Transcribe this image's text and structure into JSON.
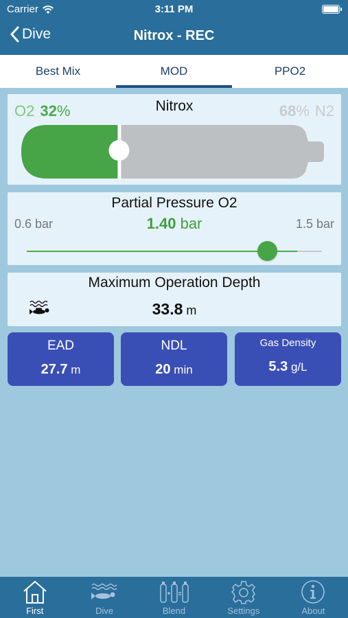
{
  "status_bar": {
    "carrier": "Carrier",
    "time": "3:11 PM"
  },
  "nav": {
    "back_label": "Dive",
    "title": "Nitrox - REC"
  },
  "tabs": [
    {
      "label": "Best Mix",
      "active": false
    },
    {
      "label": "MOD",
      "active": true
    },
    {
      "label": "PPO2",
      "active": false
    }
  ],
  "mix": {
    "title": "Nitrox",
    "o2_label": "O2",
    "o2_value": "32",
    "o2_unit": "%",
    "n2_label": "N2",
    "n2_value": "68",
    "n2_unit": "%",
    "o2_fraction": 0.32,
    "colors": {
      "o2": "#47a447",
      "n2": "#bcc0c3"
    }
  },
  "ppo2": {
    "title": "Partial Pressure O2",
    "min_label": "0.6 bar",
    "max_label": "1.5 bar",
    "value": "1.40",
    "unit": "bar",
    "slider_min": 0.6,
    "slider_max": 1.5,
    "slider_value": 1.4
  },
  "mod": {
    "title": "Maximum Operation Depth",
    "icon": "diver-icon",
    "value": "33.8",
    "unit": "m"
  },
  "stats": [
    {
      "label": "EAD",
      "value": "27.7",
      "unit": "m"
    },
    {
      "label": "NDL",
      "value": "20",
      "unit": "min"
    },
    {
      "label": "Gas Density",
      "value": "5.3",
      "unit": "g/L"
    }
  ],
  "tabbar": [
    {
      "label": "First",
      "icon": "house-icon",
      "active": true
    },
    {
      "label": "Dive",
      "icon": "diver-icon",
      "active": false
    },
    {
      "label": "Blend",
      "icon": "blend-tanks-icon",
      "active": false
    },
    {
      "label": "Settings",
      "icon": "gear-icon",
      "active": false
    },
    {
      "label": "About",
      "icon": "info-icon",
      "active": false
    }
  ],
  "theme": {
    "primary": "#2a6e9b",
    "background": "#9ec8de",
    "card": "#e6f2f9",
    "stat_button": "#3a4fb5",
    "accent_green": "#47a447"
  }
}
